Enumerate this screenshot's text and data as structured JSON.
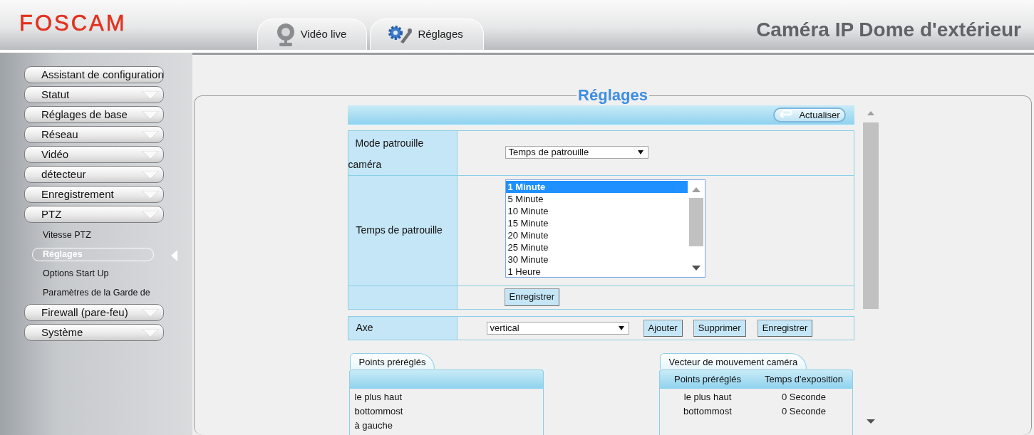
{
  "header": {
    "logo": "FOSCAM",
    "title": "Caméra IP Dome d'extérieur",
    "tabs": [
      {
        "label": "Vidéo live"
      },
      {
        "label": "Réglages"
      }
    ]
  },
  "sidebar": {
    "items": [
      {
        "label": "Assistant de configuration",
        "expandable": false
      },
      {
        "label": "Statut",
        "expandable": true
      },
      {
        "label": "Réglages de base",
        "expandable": true
      },
      {
        "label": "Réseau",
        "expandable": true
      },
      {
        "label": "Vidéo",
        "expandable": true
      },
      {
        "label": "détecteur",
        "expandable": true
      },
      {
        "label": "Enregistrement",
        "expandable": true
      },
      {
        "label": "PTZ",
        "expandable": true,
        "children": [
          {
            "label": "Vitesse PTZ",
            "selected": false
          },
          {
            "label": "Réglages",
            "selected": true
          },
          {
            "label": "Options Start Up",
            "selected": false
          },
          {
            "label": "Paramètres de la Garde de",
            "selected": false
          }
        ]
      },
      {
        "label": "Firewall (pare-feu)",
        "expandable": true
      },
      {
        "label": "Système",
        "expandable": true
      }
    ]
  },
  "main": {
    "title": "Réglages",
    "refresh_button": "Actualiser",
    "mode_row": {
      "label": "Mode patrouille caméra",
      "value": "Temps de patrouille"
    },
    "time_row": {
      "label": "Temps de patrouille",
      "options": [
        {
          "label": "1 Minute",
          "selected": true
        },
        {
          "label": "5 Minute",
          "selected": false
        },
        {
          "label": "10 Minute",
          "selected": false
        },
        {
          "label": "15 Minute",
          "selected": false
        },
        {
          "label": "20 Minute",
          "selected": false
        },
        {
          "label": "25 Minute",
          "selected": false
        },
        {
          "label": "30 Minute",
          "selected": false
        },
        {
          "label": "1 Heure",
          "selected": false
        }
      ]
    },
    "save_button": "Enregistrer",
    "axis_row": {
      "label": "Axe",
      "value": "vertical",
      "buttons": [
        "Ajouter",
        "Supprimer",
        "Enregistrer"
      ]
    },
    "presets": {
      "tab": "Points préréglés",
      "items": [
        "le plus haut",
        "bottommost",
        "à gauche"
      ]
    },
    "vector": {
      "tab": "Vecteur de mouvement caméra",
      "columns": [
        "Points préréglés",
        "Temps d'exposition"
      ],
      "rows": [
        [
          "le plus haut",
          "0 Seconde"
        ],
        [
          "bottommost",
          "0 Seconde"
        ]
      ]
    }
  }
}
